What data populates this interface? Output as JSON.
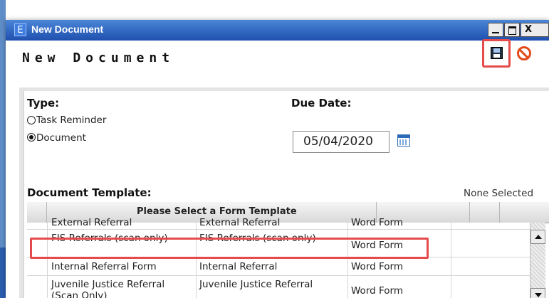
{
  "window": {
    "app_icon_letter": "E",
    "title": "New Document",
    "close_label": "X"
  },
  "page": {
    "heading": "New Document"
  },
  "form": {
    "type_label": "Type:",
    "radio_options": [
      {
        "label": "Task Reminder",
        "selected": false
      },
      {
        "label": "Document",
        "selected": true
      }
    ],
    "due_date_label": "Due Date:",
    "due_date_value": "05/04/2020",
    "template_label": "Document Template:",
    "template_status": "None Selected"
  },
  "grid": {
    "header_title": "Please Select a Form Template",
    "rows": [
      {
        "col1": "External Referral",
        "col2": "External Referral",
        "col3": "Word Form"
      },
      {
        "col1": "FIS Referrals (scan only)",
        "col2": "FIS Referrals (scan only)",
        "col3": "Word Form"
      },
      {
        "col1": "Internal Referral Form",
        "col2": "Internal Referral",
        "col3": "Word Form"
      },
      {
        "col1": "Juvenile Justice Referral (Scan Only)",
        "col2": "Juvenile Justice Referral",
        "col3": "Word Form"
      }
    ],
    "highlighted_row_index": 2
  },
  "colors": {
    "titlebar": "#1f4fae",
    "highlight": "#e64b4b"
  },
  "icons": {
    "save": "floppy-disk-icon",
    "cancel": "no-entry-icon",
    "calendar": "calendar-icon"
  }
}
